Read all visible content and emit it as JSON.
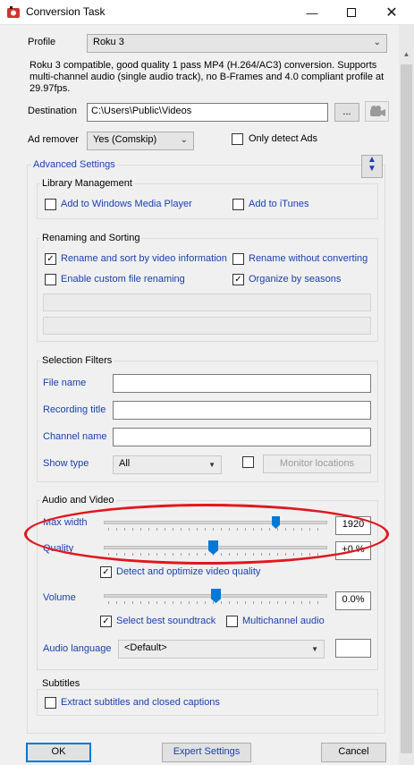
{
  "window": {
    "title": "Conversion Task"
  },
  "profile": {
    "label": "Profile",
    "value": "Roku 3",
    "description": "Roku 3 compatible, good quality 1 pass MP4 (H.264/AC3) conversion. Supports multi-channel audio (single audio track), no B-Frames and 4.0 compliant profile at 29.97fps."
  },
  "destination": {
    "label": "Destination",
    "value": "C:\\Users\\Public\\Videos",
    "browse_label": "..."
  },
  "ad_remover": {
    "label": "Ad remover",
    "value": "Yes (Comskip)",
    "only_detect_label": "Only detect Ads"
  },
  "advanced": {
    "label": "Advanced Settings"
  },
  "library": {
    "title": "Library Management",
    "wmp_label": "Add to Windows Media Player",
    "itunes_label": "Add to iTunes"
  },
  "renaming": {
    "title": "Renaming and Sorting",
    "rename_sort_label": "Rename and sort by video information",
    "rename_without_label": "Rename without converting",
    "custom_label": "Enable custom file renaming",
    "organize_label": "Organize by seasons"
  },
  "filters": {
    "title": "Selection Filters",
    "file_name_label": "File name",
    "recording_title_label": "Recording title",
    "channel_name_label": "Channel name",
    "show_type_label": "Show type",
    "show_type_value": "All",
    "monitor_label": "Monitor locations"
  },
  "av": {
    "title": "Audio and Video",
    "max_width_label": "Max width",
    "max_width_value": "1920",
    "quality_label": "Quality",
    "quality_value": "+0 %",
    "detect_label": "Detect and optimize video quality",
    "volume_label": "Volume",
    "volume_value": "0.0%",
    "soundtrack_label": "Select best soundtrack",
    "multichannel_label": "Multichannel audio",
    "audio_language_label": "Audio language",
    "audio_language_value": "<Default>"
  },
  "subtitles": {
    "title": "Subtitles",
    "extract_label": "Extract subtitles and closed captions"
  },
  "footer": {
    "ok_label": "OK",
    "expert_label": "Expert Settings",
    "cancel_label": "Cancel"
  },
  "icons": {
    "app": "app-icon",
    "minimize": "minimize-icon",
    "maximize": "maximize-icon",
    "close": "close-icon",
    "updown": "up-down-arrows-icon",
    "camera": "camera-icon",
    "chevron": "chevron-down-icon",
    "check": "checkmark-icon"
  },
  "accent_colors": {
    "link_blue": "#1a3fb0",
    "slider_blue": "#0078d7",
    "highlight_red": "#e0181f"
  }
}
